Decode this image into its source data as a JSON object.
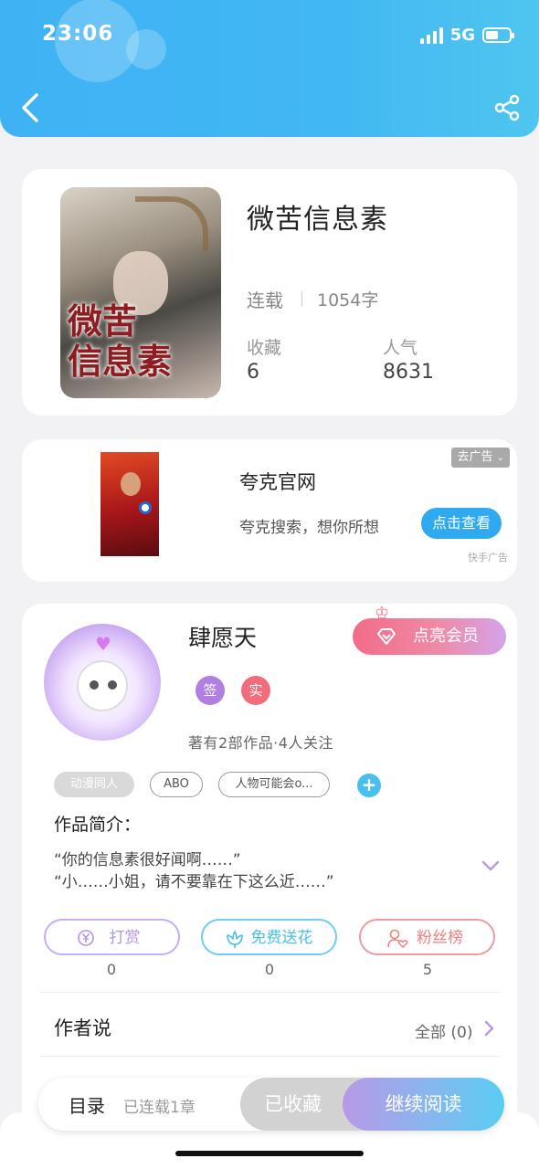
{
  "status_bar": {
    "time": "23:06",
    "network": "5G",
    "battery_level": 0.55
  },
  "header": {
    "back_icon": "chevron-left-icon",
    "share_icon": "share-icon"
  },
  "book": {
    "title": "微苦信息素",
    "cover_text": "微苦\n信息素",
    "status": "连载",
    "word_count": "1054字",
    "collect_label": "收藏",
    "collect_value": "6",
    "popularity_label": "人气",
    "popularity_value": "8631"
  },
  "ad": {
    "title": "夸克官网",
    "description": "夸克搜索，想你所想",
    "close_label": "去广告",
    "button_label": "点击查看",
    "source": "快手广告"
  },
  "author": {
    "name": "肆愿天",
    "vip_button": "点亮会员",
    "badges": [
      {
        "label": "签",
        "color": "#b07fe0"
      },
      {
        "label": "实",
        "color": "#f26d7b"
      }
    ],
    "meta": "著有2部作品·4人关注",
    "tags": [
      "动漫同人",
      "ABO",
      "人物可能会o..."
    ]
  },
  "intro": {
    "label": "作品简介：",
    "lines": [
      "“你的信息素很好闻啊……”",
      "“小……小姐，请不要靠在下这么近……”"
    ]
  },
  "actions": [
    {
      "label": "打赏",
      "count": "0",
      "icon": "yen-coin-icon",
      "color": "#b394e6"
    },
    {
      "label": "免费送花",
      "count": "0",
      "icon": "flower-icon",
      "color": "#49bfe8"
    },
    {
      "label": "粉丝榜",
      "count": "5",
      "icon": "user-heart-icon",
      "color": "#ee7e84"
    }
  ],
  "author_say": {
    "label": "作者说",
    "all_label": "全部 (0)"
  },
  "reader_bar": {
    "toc_label": "目录",
    "toc_meta": "已连载1章",
    "collected_label": "已收藏",
    "read_label": "继续阅读"
  }
}
